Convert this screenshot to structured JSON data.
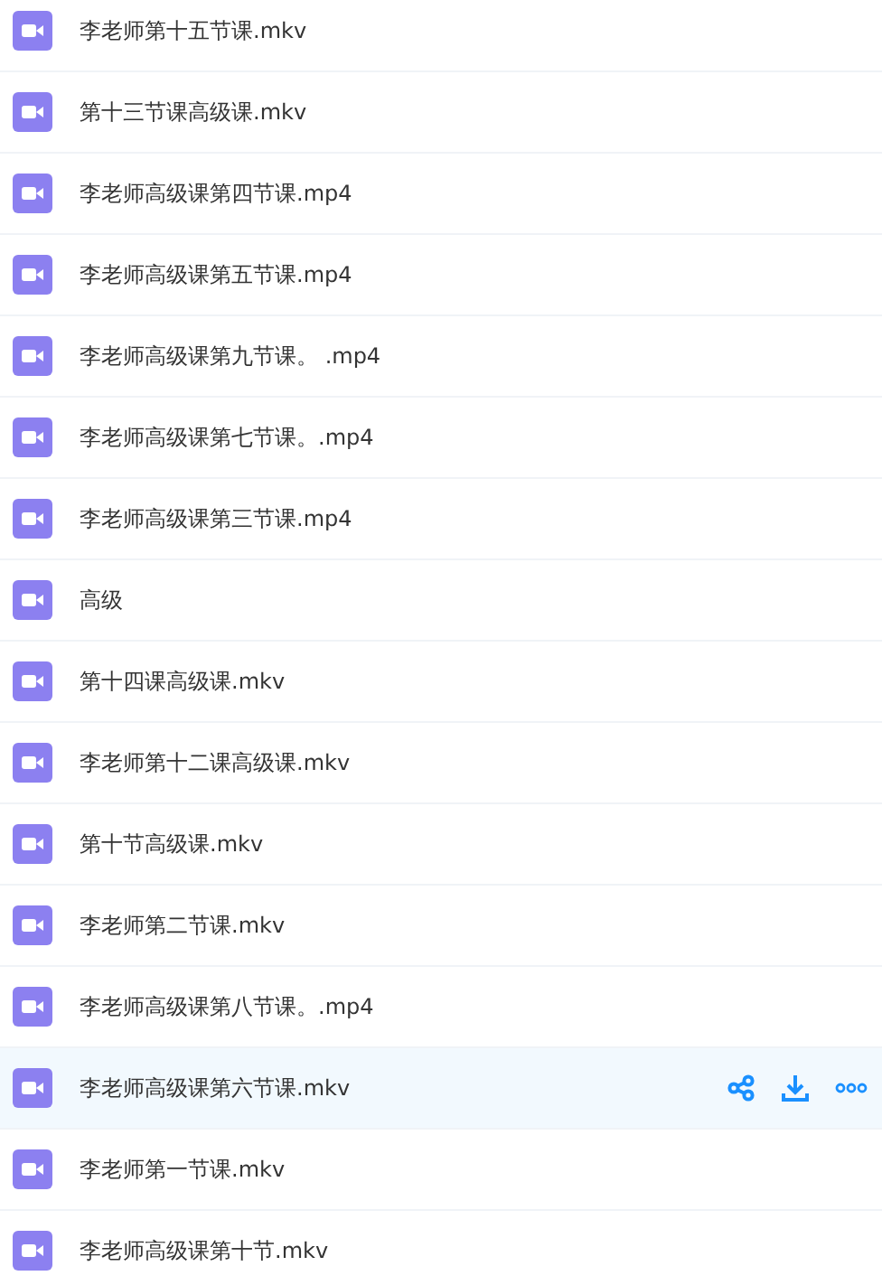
{
  "files": [
    {
      "name": "李老师第十五节课.mkv",
      "selected": false
    },
    {
      "name": "第十三节课高级课.mkv",
      "selected": false
    },
    {
      "name": "李老师高级课第四节课.mp4",
      "selected": false
    },
    {
      "name": "李老师高级课第五节课.mp4",
      "selected": false
    },
    {
      "name": "李老师高级课第九节课。 .mp4",
      "selected": false
    },
    {
      "name": "李老师高级课第七节课。.mp4",
      "selected": false
    },
    {
      "name": "李老师高级课第三节课.mp4",
      "selected": false
    },
    {
      "name": "高级",
      "selected": false
    },
    {
      "name": "第十四课高级课.mkv",
      "selected": false
    },
    {
      "name": "李老师第十二课高级课.mkv",
      "selected": false
    },
    {
      "name": "第十节高级课.mkv",
      "selected": false
    },
    {
      "name": "李老师第二节课.mkv",
      "selected": false
    },
    {
      "name": "李老师高级课第八节课。.mp4",
      "selected": false
    },
    {
      "name": "李老师高级课第六节课.mkv",
      "selected": true
    },
    {
      "name": "李老师第一节课.mkv",
      "selected": false
    },
    {
      "name": "李老师高级课第十节.mkv",
      "selected": false
    }
  ]
}
